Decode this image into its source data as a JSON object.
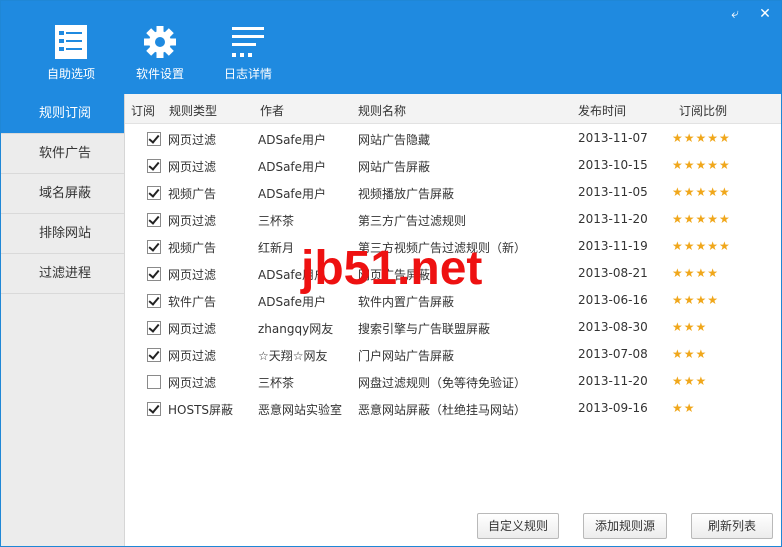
{
  "toolbar": {
    "items": [
      {
        "label": "自助选项",
        "icon": "checklist-icon"
      },
      {
        "label": "软件设置",
        "icon": "gear-icon"
      },
      {
        "label": "日志详情",
        "icon": "list-icon"
      }
    ],
    "back_glyph": "⤶",
    "close_glyph": "✕"
  },
  "sidebar": {
    "items": [
      {
        "label": "规则订阅",
        "active": true
      },
      {
        "label": "软件广告",
        "active": false
      },
      {
        "label": "域名屏蔽",
        "active": false
      },
      {
        "label": "排除网站",
        "active": false
      },
      {
        "label": "过滤进程",
        "active": false
      }
    ]
  },
  "table": {
    "headers": [
      "订阅",
      "规则类型",
      "作者",
      "规则名称",
      "发布时间",
      "订阅比例"
    ],
    "rows": [
      {
        "checked": true,
        "type": "网页过滤",
        "author": "ADSafe用户",
        "name": "网站广告隐藏",
        "date": "2013-11-07",
        "stars": "★★★★★"
      },
      {
        "checked": true,
        "type": "网页过滤",
        "author": "ADSafe用户",
        "name": "网站广告屏蔽",
        "date": "2013-10-15",
        "stars": "★★★★★"
      },
      {
        "checked": true,
        "type": "视频广告",
        "author": "ADSafe用户",
        "name": "视频播放广告屏蔽",
        "date": "2013-11-05",
        "stars": "★★★★★"
      },
      {
        "checked": true,
        "type": "网页过滤",
        "author": "三杯茶",
        "name": "第三方广告过滤规则",
        "date": "2013-11-20",
        "stars": "★★★★★"
      },
      {
        "checked": true,
        "type": "视频广告",
        "author": "红新月",
        "name": "第三方视频广告过滤规则（新）",
        "date": "2013-11-19",
        "stars": "★★★★★"
      },
      {
        "checked": true,
        "type": "网页过滤",
        "author": "ADSafe用户",
        "name": "网页广告屏蔽",
        "date": "2013-08-21",
        "stars": "★★★★"
      },
      {
        "checked": true,
        "type": "软件广告",
        "author": "ADSafe用户",
        "name": "软件内置广告屏蔽",
        "date": "2013-06-16",
        "stars": "★★★★"
      },
      {
        "checked": true,
        "type": "网页过滤",
        "author": "zhangqy网友",
        "name": "搜索引擎与广告联盟屏蔽",
        "date": "2013-08-30",
        "stars": "★★★"
      },
      {
        "checked": true,
        "type": "网页过滤",
        "author": "☆天翔☆网友",
        "name": "门户网站广告屏蔽",
        "date": "2013-07-08",
        "stars": "★★★"
      },
      {
        "checked": false,
        "type": "网页过滤",
        "author": "三杯茶",
        "name": "网盘过滤规则（免等待免验证）",
        "date": "2013-11-20",
        "stars": "★★★"
      },
      {
        "checked": true,
        "type": "HOSTS屏蔽",
        "author": "恶意网站实验室",
        "name": "恶意网站屏蔽（杜绝挂马网站）",
        "date": "2013-09-16",
        "stars": "★★"
      }
    ]
  },
  "buttons": {
    "custom_rule": "自定义规则",
    "add_source": "添加规则源",
    "refresh": "刷新列表"
  },
  "watermark": "jb51.net",
  "colors": {
    "accent": "#1f8ae0",
    "star": "#f0a71b",
    "watermark": "#ee1111"
  }
}
